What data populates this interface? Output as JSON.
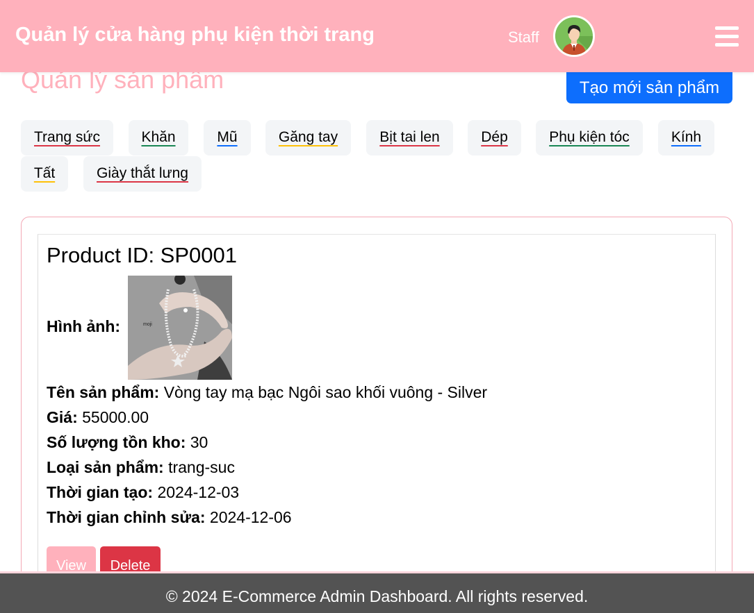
{
  "header": {
    "brand": "Quản lý cửa hàng phụ kiện thời trang",
    "user_role": "Staff",
    "avatar_icon": "user-avatar-icon",
    "menu_icon": "hamburger-menu-icon",
    "background_color": "#ffb1bc"
  },
  "page": {
    "title": "Quản lý sản phẩm",
    "create_button": "Tạo mới sản phẩm"
  },
  "categories": [
    {
      "label": "Trang sức",
      "underline": "#dc3545"
    },
    {
      "label": "Khăn",
      "underline": "#198754"
    },
    {
      "label": "Mũ",
      "underline": "#0d6efd"
    },
    {
      "label": "Găng tay",
      "underline": "#ffc107"
    },
    {
      "label": "Bịt tai len",
      "underline": "#dc3545"
    },
    {
      "label": "Dép",
      "underline": "#dc3545"
    },
    {
      "label": "Phụ kiện tóc",
      "underline": "#198754"
    },
    {
      "label": "Kính",
      "underline": "#0d6efd"
    },
    {
      "label": "Tất",
      "underline": "#ffc107"
    },
    {
      "label": "Giày thắt lưng",
      "underline": "#dc3545"
    }
  ],
  "product": {
    "id_label": "Product ID: SP0001",
    "image_label": "Hình ảnh:",
    "image_brand_text": "moji",
    "name_label": "Tên sản phẩm:",
    "name_value": "Vòng tay mạ bạc Ngôi sao khối vuông - Silver",
    "price_label": "Giá:",
    "price_value": "55000.00",
    "stock_label": "Số lượng tồn kho:",
    "stock_value": "30",
    "type_label": "Loại sản phẩm:",
    "type_value": "trang-suc",
    "created_label": "Thời gian tạo:",
    "created_value": "2024-12-03",
    "updated_label": "Thời gian chỉnh sửa:",
    "updated_value": "2024-12-06",
    "view_button": "View",
    "delete_button": "Delete"
  },
  "footer": {
    "text": "© 2024 E-Commerce Admin Dashboard. All rights reserved."
  },
  "colors": {
    "accent_pink": "#ffb1bc",
    "primary_blue": "#0d6efd",
    "danger_red": "#dc3545",
    "footer_bg": "#535353"
  }
}
